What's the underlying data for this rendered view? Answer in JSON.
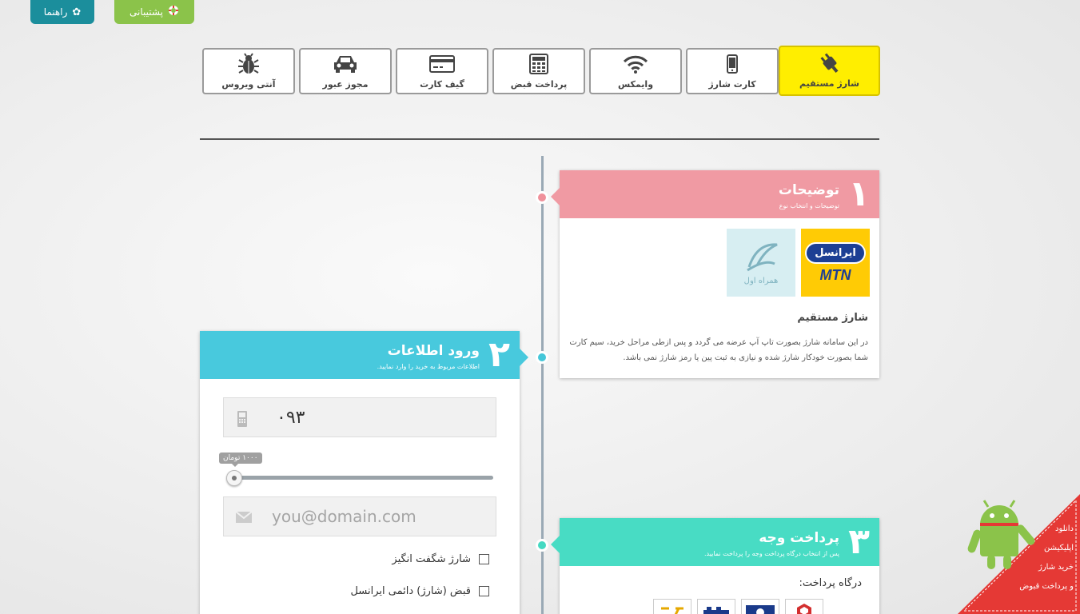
{
  "top": {
    "guide_label": "راهنما",
    "support_label": "پشتیبانی"
  },
  "nav": {
    "tabs": [
      {
        "label": "شارژ مستقیم",
        "icon": "plug-icon",
        "active": true
      },
      {
        "label": "کارت شارژ",
        "icon": "phone-icon",
        "active": false
      },
      {
        "label": "وایمکس",
        "icon": "wifi-icon",
        "active": false
      },
      {
        "label": "پرداخت قبض",
        "icon": "calculator-icon",
        "active": false
      },
      {
        "label": "گیف کارت",
        "icon": "credit-card-icon",
        "active": false
      },
      {
        "label": "مجوز عبور",
        "icon": "car-icon",
        "active": false
      },
      {
        "label": "آنتی ویروس",
        "icon": "bug-icon",
        "active": false
      }
    ]
  },
  "step1": {
    "number": "۱",
    "title": "توضیحات",
    "subtitle": "توضیحات و انتخاب نوع",
    "logos": {
      "irancell_text": "ایرانسل",
      "mtn_text": "MTN",
      "mci_text": "همراه اول"
    },
    "desc_title": "شارژ مستقیم",
    "desc_text": "در این سامانه شارژ بصورت تاپ آپ عرضه می گردد و پس ازطی مراحل خرید، سیم کارت شما بصورت خودکار شارژ شده و نیازی به ثبت پین یا رمز شارژ نمی باشد."
  },
  "step2": {
    "number": "۲",
    "title": "ورود اطلاعات",
    "subtitle": "اطلاعات مربوط به خرید را وارد نمایید.",
    "phone_value": "۰۹۳",
    "amount_label": "۱۰۰۰ تومان",
    "amount_fraction": 0,
    "email_placeholder": "you@domain.com",
    "check1_label": "شارژ شگفت انگیز",
    "check2_label": "قبض (شارژ) دائمی ایرانسل"
  },
  "step3": {
    "number": "۳",
    "title": "پرداخت وجه",
    "subtitle": "پس از انتخاب درگاه پرداخت وجه را پرداخت نمایید.",
    "gateway_label": "درگاه پرداخت:"
  },
  "promo": {
    "line1": "دانلود",
    "line2": "اپلیکیشن",
    "line3": "خرید شارژ",
    "line4": "و پرداخت قبوض"
  },
  "colors": {
    "active_tab": "#ffee00",
    "step1": "#f09aa3",
    "step2": "#48c9dd",
    "step3": "#48dcc4",
    "promo": "#e53935"
  }
}
